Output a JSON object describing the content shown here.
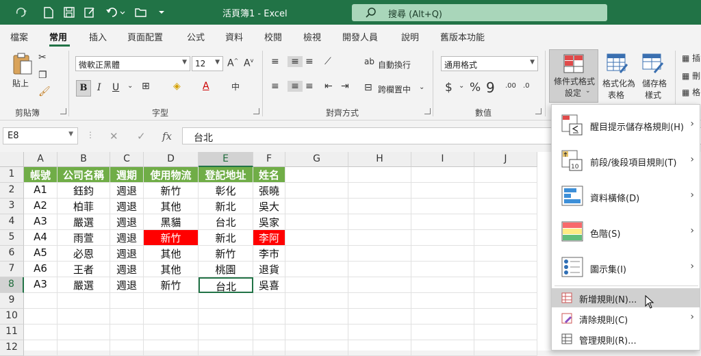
{
  "window": {
    "title": "活頁簿1  -  Excel",
    "search_placeholder": "搜尋 (Alt+Q)"
  },
  "tabs": [
    "檔案",
    "常用",
    "插入",
    "頁面配置",
    "公式",
    "資料",
    "校閱",
    "檢視",
    "開發人員",
    "說明",
    "舊版本功能"
  ],
  "active_tab": "常用",
  "ribbon": {
    "clipboard": {
      "paste_label": "貼上",
      "group_label": "剪貼簿"
    },
    "font": {
      "name": "微軟正黑體",
      "size": "12",
      "group_label": "字型",
      "bold": "B",
      "italic": "I",
      "underline": "U"
    },
    "alignment": {
      "wrap_label": "自動換行",
      "merge_label": "跨欄置中",
      "group_label": "對齊方式"
    },
    "number": {
      "format": "通用格式",
      "group_label": "數值"
    },
    "styles": {
      "cf_label_1": "條件式格式",
      "cf_label_2": "設定",
      "fmt_table_1": "格式化為",
      "fmt_table_2": "表格",
      "cell_style_1": "儲存格",
      "cell_style_2": "樣式"
    },
    "right_partial": [
      "插",
      "刪",
      "格"
    ]
  },
  "formula_bar": {
    "name_box": "E8",
    "content": "台北"
  },
  "columns": [
    "A",
    "B",
    "C",
    "D",
    "E",
    "F",
    "G",
    "H",
    "I",
    "J"
  ],
  "rows": [
    "1",
    "2",
    "3",
    "4",
    "5",
    "6",
    "7",
    "8",
    "9",
    "10",
    "11",
    "12"
  ],
  "table": {
    "headers": [
      "帳號",
      "公司名稱",
      "週期",
      "使用物流",
      "登記地址",
      "姓名"
    ],
    "data": [
      [
        "A1",
        "鈺鈞",
        "週退",
        "新竹",
        "彰化",
        "張曉"
      ],
      [
        "A2",
        "柏菲",
        "週退",
        "其他",
        "新北",
        "吳大"
      ],
      [
        "A3",
        "嚴選",
        "週退",
        "黑貓",
        "台北",
        "吳家"
      ],
      [
        "A4",
        "雨萱",
        "週退",
        "新竹",
        "新北",
        "李阿"
      ],
      [
        "A5",
        "必恩",
        "週退",
        "其他",
        "新竹",
        "李市"
      ],
      [
        "A6",
        "王者",
        "週退",
        "其他",
        "桃園",
        "退貨"
      ],
      [
        "A3",
        "嚴選",
        "週退",
        "新竹",
        "台北",
        "吳喜"
      ]
    ]
  },
  "menu": {
    "items": [
      {
        "label": "醒目提示儲存格規則(H)",
        "icon": "highlight-rules-icon"
      },
      {
        "label": "前段/後段項目規則(T)",
        "icon": "top-bottom-rules-icon"
      },
      {
        "label": "資料橫條(D)",
        "icon": "data-bars-icon"
      },
      {
        "label": "色階(S)",
        "icon": "color-scales-icon"
      },
      {
        "label": "圖示集(I)",
        "icon": "icon-sets-icon"
      }
    ],
    "small_items": [
      {
        "label": "新增規則(N)...",
        "icon": "new-rule-icon"
      },
      {
        "label": "清除規則(C)",
        "icon": "clear-rules-icon"
      },
      {
        "label": "管理規則(R)...",
        "icon": "manage-rules-icon"
      }
    ]
  },
  "colors": {
    "excel_green": "#217346",
    "header_green": "#70ad47",
    "highlight_red": "#ff0000"
  }
}
